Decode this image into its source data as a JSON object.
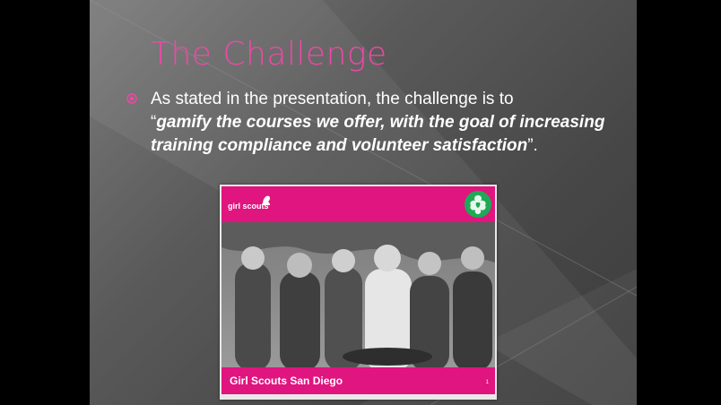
{
  "slide": {
    "title": "The Challenge",
    "bullet": {
      "text_plain": "As stated in the presentation, the challenge is to",
      "quote_open": "“",
      "quote_emphasis": "gamify the courses we offer, with the goal of increasing training compliance and volunteer satisfaction",
      "quote_close": "”."
    }
  },
  "image_card": {
    "brand": "girl scouts",
    "caption": "Girl Scouts San Diego",
    "page_number": "1"
  },
  "colors": {
    "accent": "#ec4aa5",
    "brand_pink": "#e0157f",
    "brand_green": "#1eaa55",
    "text": "#ffffff"
  }
}
